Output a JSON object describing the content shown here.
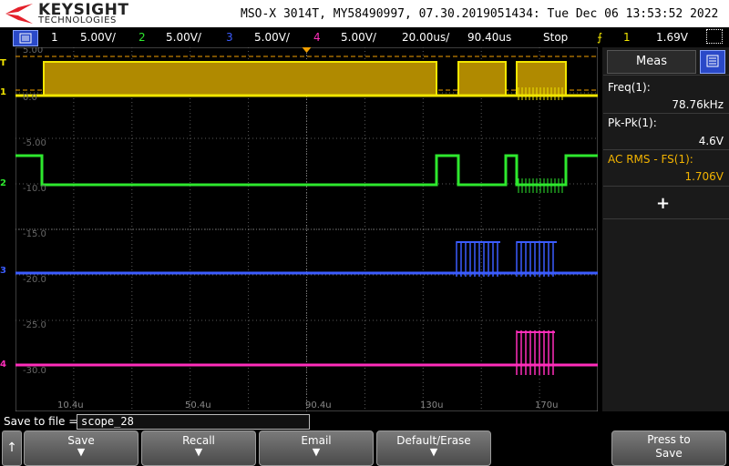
{
  "brand": {
    "name": "KEYSIGHT",
    "sub": "TECHNOLOGIES"
  },
  "header": {
    "info": "MSO-X 3014T, MY58490997, 07.30.2019051434: Tue Dec 06 13:53:52 2022"
  },
  "channels": [
    {
      "num": "1",
      "scale": "5.00V/",
      "color": "#f2e600"
    },
    {
      "num": "2",
      "scale": "5.00V/",
      "color": "#2ee82e"
    },
    {
      "num": "3",
      "scale": "5.00V/",
      "color": "#3b5cff"
    },
    {
      "num": "4",
      "scale": "5.00V/",
      "color": "#ff2ebb"
    }
  ],
  "timebase": {
    "scale": "20.00us/",
    "delay": "90.40us"
  },
  "run_state": "Stop",
  "trigger": {
    "channel": "1",
    "level": "1.69V",
    "color": "#f2e600"
  },
  "grid_labels": {
    "y": [
      "5.00",
      "0.0",
      "-5.00",
      "-10.0",
      "-15.0",
      "-20.0",
      "-25.0",
      "-30.0"
    ],
    "x": [
      "10.4u",
      "50.4u",
      "90.4u",
      "130u",
      "170u"
    ]
  },
  "markers": {
    "trigger_mark": "T",
    "ch1": "1",
    "ch2": "2",
    "ch3": "3",
    "ch4": "4"
  },
  "meas": {
    "tab": "Meas",
    "items": [
      {
        "label": "Freq(1):",
        "value": "78.76kHz",
        "color": "#ffffff"
      },
      {
        "label": "Pk-Pk(1):",
        "value": "4.6V",
        "color": "#ffffff"
      },
      {
        "label": "AC RMS - FS(1):",
        "value": "1.706V",
        "color": "#f2b300"
      }
    ],
    "add": "+"
  },
  "save": {
    "label": "Save to file =",
    "value": "scope_28"
  },
  "softkeys": [
    {
      "label": "Save"
    },
    {
      "label": "Recall"
    },
    {
      "label": "Email"
    },
    {
      "label": "Default/Erase"
    }
  ],
  "press_to_save": {
    "line1": "Press to",
    "line2": "Save"
  }
}
